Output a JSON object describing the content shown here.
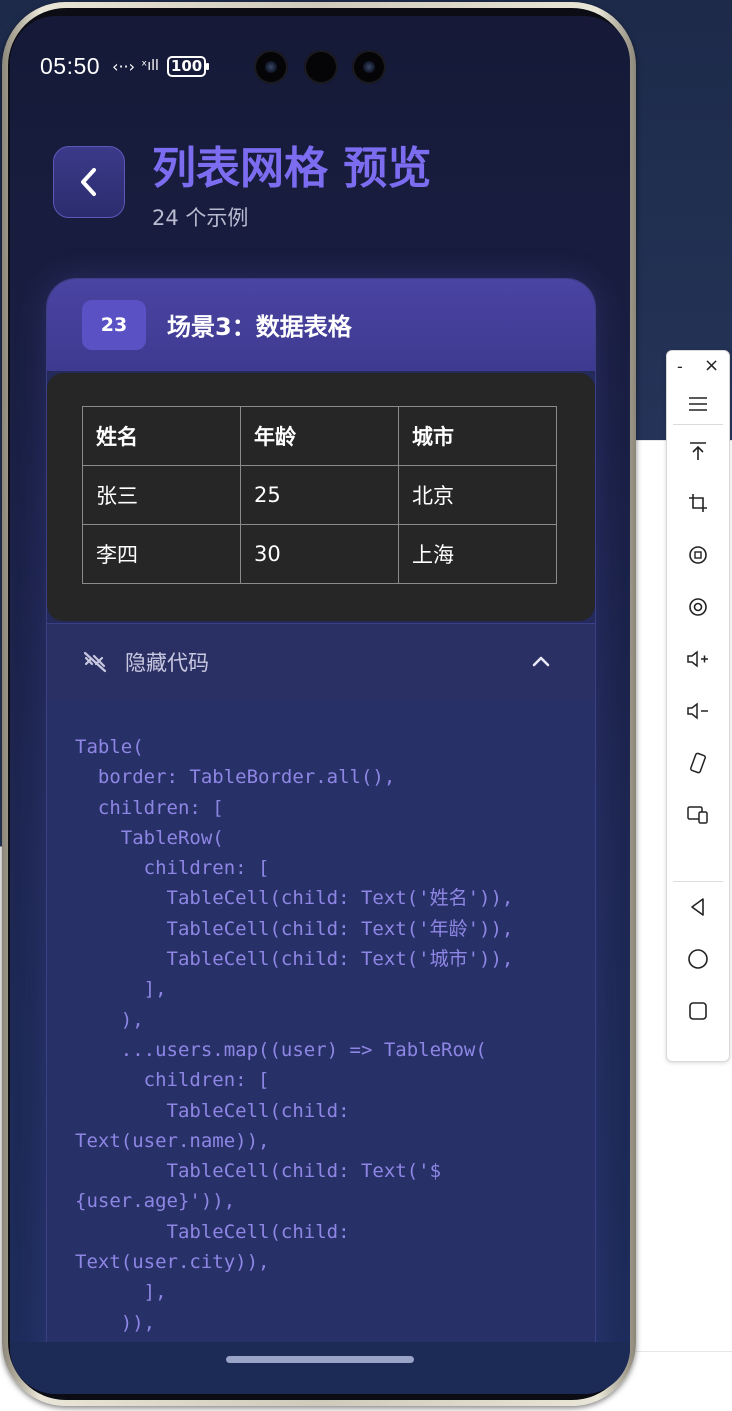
{
  "status_bar": {
    "time": "05:50",
    "data_icon": "‹··›",
    "signal_icon": "ˣıll",
    "battery": "100"
  },
  "header": {
    "back_icon": "back-chevron-icon",
    "title": "列表网格 预览",
    "subtitle": "24 个示例"
  },
  "card": {
    "badge": "23",
    "title": "场景3：数据表格",
    "table": {
      "headers": [
        "姓名",
        "年龄",
        "城市"
      ],
      "rows": [
        [
          "张三",
          "25",
          "北京"
        ],
        [
          "李四",
          "30",
          "上海"
        ]
      ]
    },
    "toggle_label": "隐藏代码",
    "code": "Table(\n  border: TableBorder.all(),\n  children: [\n    TableRow(\n      children: [\n        TableCell(child: Text('姓名')),\n        TableCell(child: Text('年龄')),\n        TableCell(child: Text('城市')),\n      ],\n    ),\n    ...users.map((user) => TableRow(\n      children: [\n        TableCell(child:\nText(user.name)),\n        TableCell(child: Text('$\n{user.age}')),\n        TableCell(child:\nText(user.city)),\n      ],\n    )),"
  },
  "toolbar": {
    "minimize": "-",
    "close": "×",
    "items": [
      "menu-icon",
      "pin-top-icon",
      "crop-icon",
      "rotate-icon",
      "screen-record-icon",
      "volume-up-icon",
      "volume-down-icon",
      "rotate-device-icon",
      "screen-mirror-icon",
      "nav-back-icon",
      "nav-home-icon",
      "nav-recents-icon"
    ]
  },
  "colors": {
    "accent": "#7b6cf0",
    "card_head": "#4a44a2",
    "code_text": "#8e86e4"
  }
}
